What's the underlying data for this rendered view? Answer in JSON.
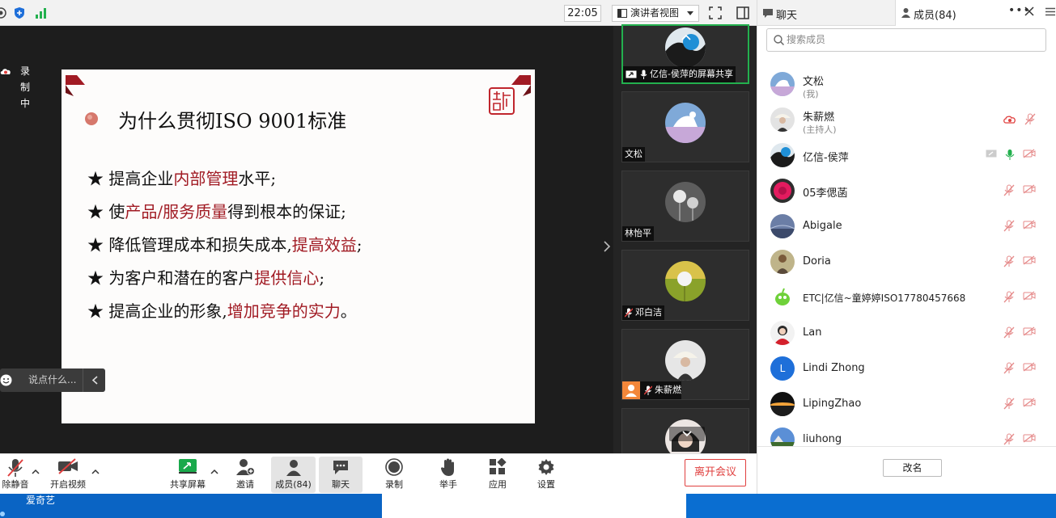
{
  "topbar": {
    "time": "22:05",
    "view_label": "演讲者视图"
  },
  "recording": {
    "label": "录制中"
  },
  "slide": {
    "title": "为什么贯彻ISO 9001标准",
    "bullets": [
      {
        "star": "★",
        "pre": " 提高企业",
        "hl": "内部管理",
        "post": "水平;"
      },
      {
        "star": "★",
        "pre": " 使",
        "hl": "产品/服务质量",
        "post": "得到根本的保证;"
      },
      {
        "star": "★",
        "pre": " 降低管理成本和损失成本,",
        "hl": "提高效益",
        "post": ";"
      },
      {
        "star": "★",
        "pre": " 为客户和潜在的客户",
        "hl": "提供信心",
        "post": ";"
      },
      {
        "star": "★",
        "pre": " 提高企业的形象,",
        "hl": "增加竞争的实力",
        "post": "。"
      }
    ]
  },
  "chat_input": {
    "placeholder": "说点什么..."
  },
  "thumbnails": [
    {
      "name": "亿信-侯萍的屏幕共享"
    },
    {
      "name": "文松"
    },
    {
      "name": "林怡平"
    },
    {
      "name": "邓白洁"
    },
    {
      "name": "朱薪燃"
    }
  ],
  "toolbar": {
    "mute": "除静音",
    "video": "开启视频",
    "share": "共享屏幕",
    "invite": "邀请",
    "members": "成员(84)",
    "chat": "聊天",
    "record": "录制",
    "raise": "举手",
    "apps": "应用",
    "settings": "设置",
    "leave": "离开会议"
  },
  "taskbar": {
    "app": "爱奇艺"
  },
  "panel": {
    "tab_chat": "聊天",
    "tab_members": "成员(84)",
    "search_placeholder": "搜索成员",
    "rename": "改名",
    "members": [
      {
        "name": "文松",
        "sub": "(我)"
      },
      {
        "name": "朱薪燃",
        "sub": "(主持人)"
      },
      {
        "name": "亿信-侯萍",
        "sub": ""
      },
      {
        "name": "05李偲菡",
        "sub": ""
      },
      {
        "name": "Abigale",
        "sub": ""
      },
      {
        "name": "Doria",
        "sub": ""
      },
      {
        "name": "ETC|亿信~童婷婷ISO17780457668",
        "sub": ""
      },
      {
        "name": "Lan",
        "sub": ""
      },
      {
        "name": "Lindi Zhong",
        "sub": "",
        "initial": "L"
      },
      {
        "name": "LipingZhao",
        "sub": ""
      },
      {
        "name": "liuhong",
        "sub": ""
      }
    ]
  },
  "colors": {
    "accent_red": "#a11b24",
    "leave_red": "#e0403f",
    "active_green": "#23b04e",
    "taskbar_blue": "#0a6ed1"
  }
}
